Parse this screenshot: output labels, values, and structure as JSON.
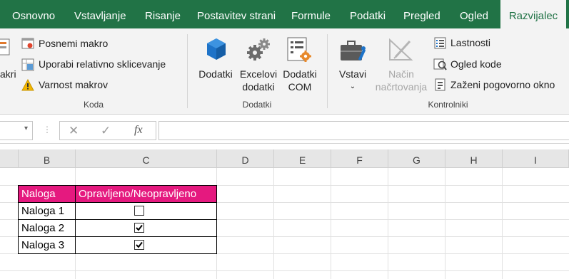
{
  "tabs": [
    {
      "label": "Osnovno"
    },
    {
      "label": "Vstavljanje"
    },
    {
      "label": "Risanje"
    },
    {
      "label": "Postavitev strani"
    },
    {
      "label": "Formule"
    },
    {
      "label": "Podatki"
    },
    {
      "label": "Pregled"
    },
    {
      "label": "Ogled"
    },
    {
      "label": "Razvijalec"
    }
  ],
  "ribbon": {
    "koda": {
      "partial_label": "akri",
      "record_macro": "Posnemi makro",
      "relative_refs": "Uporabi relativno sklicevanje",
      "macro_security": "Varnost makrov",
      "group_title": "Koda"
    },
    "dodatki": {
      "addins": "Dodatki",
      "excel_addins_1": "Excelovi",
      "excel_addins_2": "dodatki",
      "com_addins_1": "Dodatki",
      "com_addins_2": "COM",
      "group_title": "Dodatki"
    },
    "kontrolniki": {
      "insert": "Vstavi",
      "design_mode_1": "Način",
      "design_mode_2": "načrtovanja",
      "properties": "Lastnosti",
      "view_code": "Ogled kode",
      "run_dialog": "Zaženi pogovorno okno",
      "group_title": "Kontrolniki"
    }
  },
  "formula_bar": {
    "fx_label": "fx",
    "value": ""
  },
  "columns": [
    "B",
    "C",
    "D",
    "E",
    "F",
    "G",
    "H",
    "I"
  ],
  "table": {
    "headers": [
      "Naloga",
      "Opravljeno/Neopravljeno"
    ],
    "rows": [
      {
        "task": "Naloga 1",
        "done": false
      },
      {
        "task": "Naloga 2",
        "done": true
      },
      {
        "task": "Naloga 3",
        "done": true
      }
    ]
  },
  "colors": {
    "tab_green": "#217346",
    "header_pink": "#e5197f"
  }
}
